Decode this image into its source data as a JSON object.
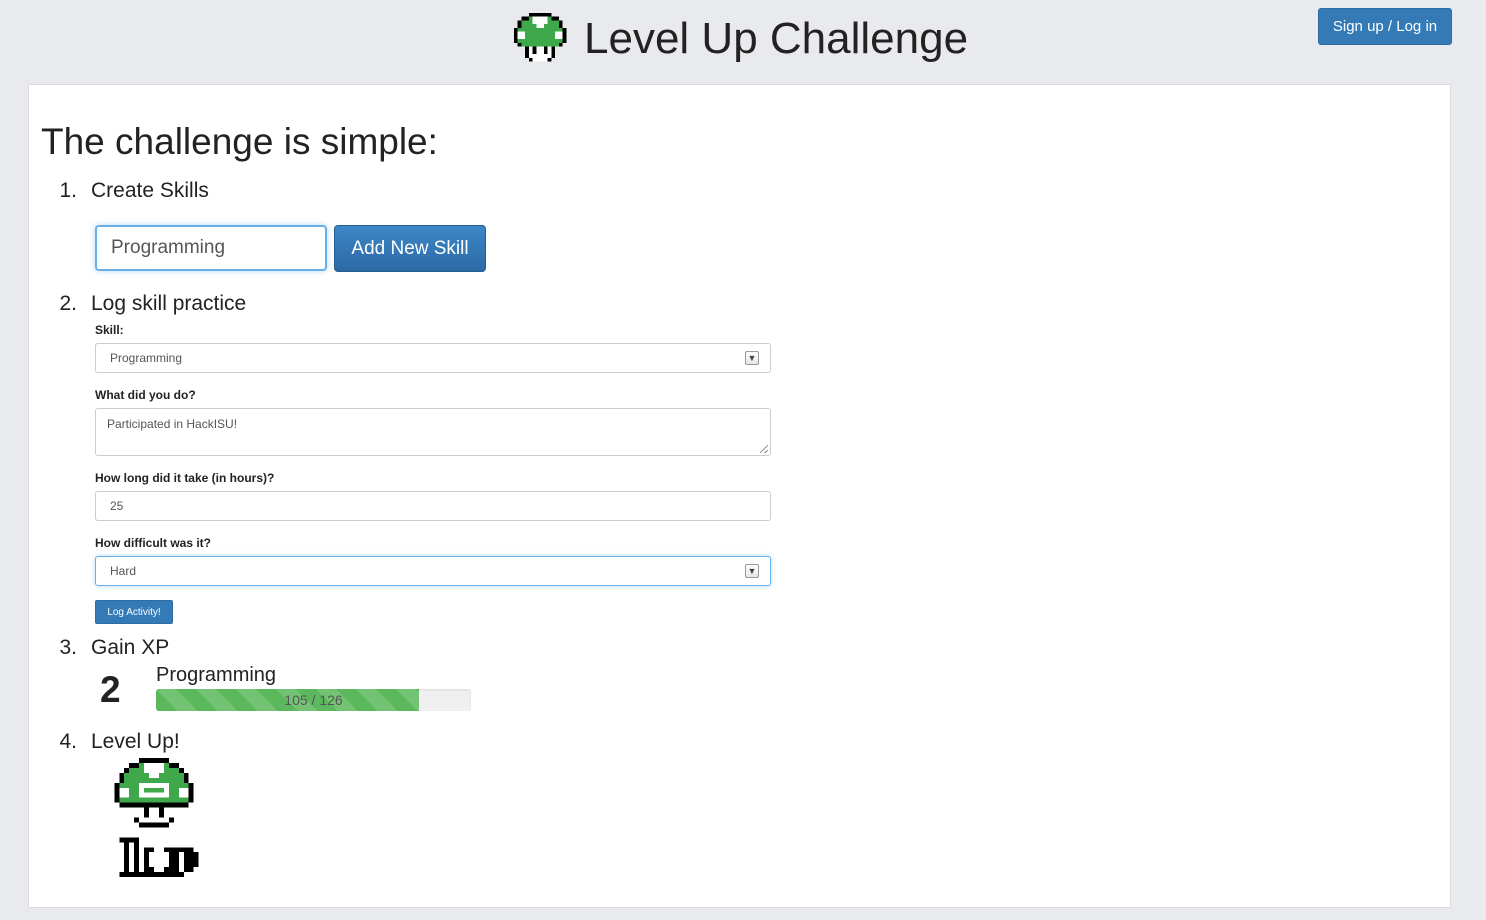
{
  "header": {
    "title": "Level Up Challenge",
    "logo_icon": "mushroom-icon",
    "signup_label": "Sign up / Log in"
  },
  "main": {
    "heading": "The challenge is simple:",
    "steps": [
      {
        "num": "1.",
        "label": "Create Skills"
      },
      {
        "num": "2.",
        "label": "Log skill practice"
      },
      {
        "num": "3.",
        "label": "Gain XP"
      },
      {
        "num": "4.",
        "label": "Level Up!"
      }
    ],
    "create_skill": {
      "input_value": "Programming",
      "button_label": "Add New Skill"
    },
    "log_form": {
      "skill_label": "Skill:",
      "skill_value": "Programming",
      "what_label": "What did you do?",
      "what_value": "Participated in HackISU!",
      "hours_label": "How long did it take (in hours)?",
      "hours_value": "25",
      "difficulty_label": "How difficult was it?",
      "difficulty_value": "Hard",
      "submit_label": "Log Activity!"
    },
    "xp": {
      "level": "2",
      "skill_name": "Programming",
      "current": 105,
      "max": 126,
      "progress_text": "105 / 126"
    },
    "level_up_icon": "1up-mushroom-icon",
    "level_up_badge": "1up"
  },
  "colors": {
    "primary": "#337ab7",
    "xp_green": "#5cb85c",
    "mushroom_green": "#3ea84a"
  }
}
